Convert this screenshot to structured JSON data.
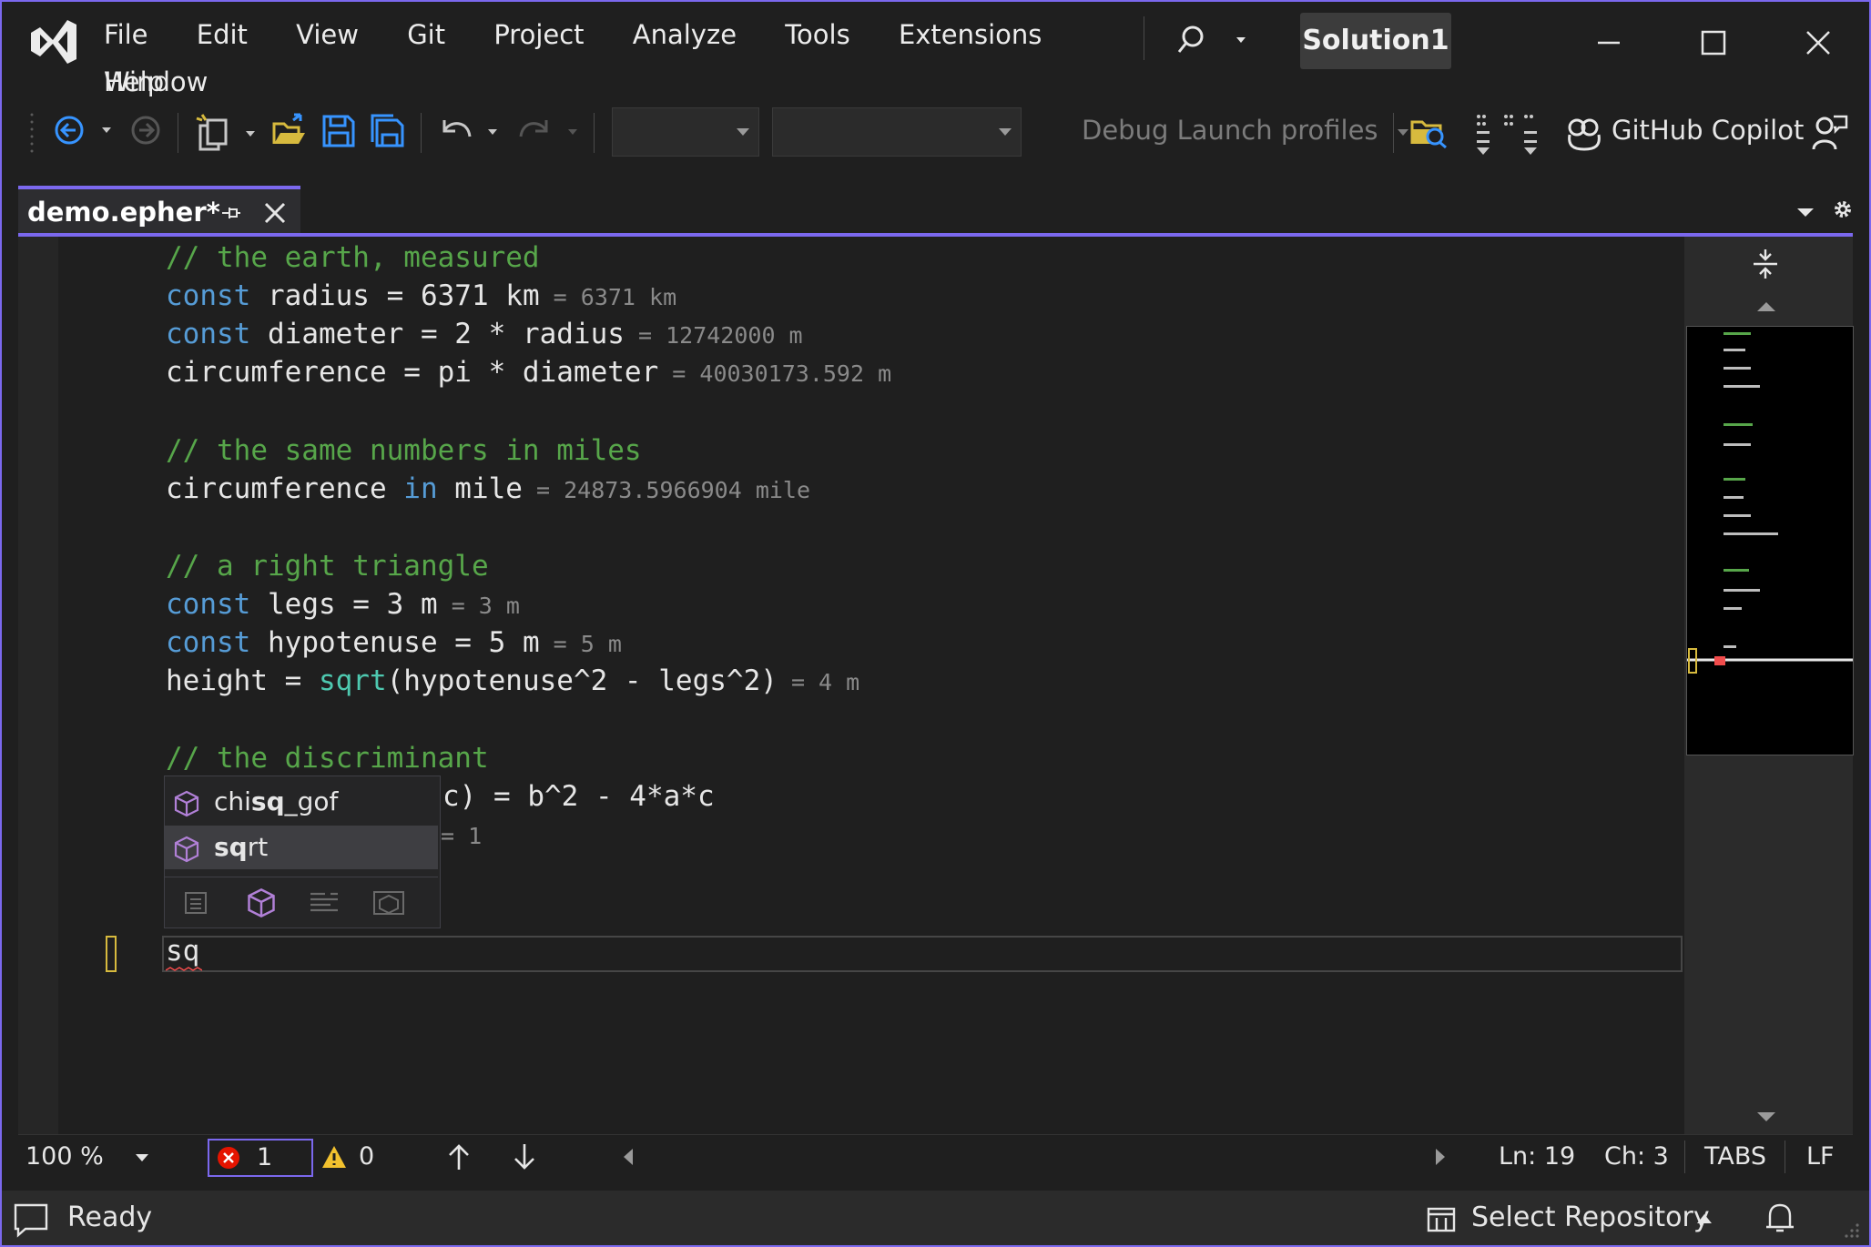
{
  "menu": {
    "items": [
      "File",
      "Edit",
      "View",
      "Git",
      "Project",
      "Analyze",
      "Tools",
      "Extensions",
      "Window"
    ],
    "help": "Help"
  },
  "solution": "Solution1",
  "toolbar": {
    "debug_label": "Debug Launch profiles",
    "copilot_label": "GitHub Copilot"
  },
  "tab": {
    "label": "demo.epher*"
  },
  "code": {
    "l1": "// the earth, measured",
    "l2_kw": "const",
    "l2": " radius = 6371 km",
    "l2_res": " = 6371 km",
    "l3_kw": "const",
    "l3": " diameter = 2 * radius",
    "l3_res": " = 12742000 m",
    "l4": "circumference = pi * diameter",
    "l4_res": " = 40030173.592 m",
    "l6": "// the same numbers in miles",
    "l7_a": "circumference ",
    "l7_kw": "in",
    "l7_b": " mile",
    "l7_res": " = 24873.5966904 mile",
    "l9": "// a right triangle",
    "l10_kw": "const",
    "l10": " legs = 3 m",
    "l10_res": " = 3 m",
    "l11_kw": "const",
    "l11": " hypotenuse = 5 m",
    "l11_res": " = 5 m",
    "l12_a": "height = ",
    "l12_fn": "sqrt",
    "l12_b": "(hypotenuse^2 - legs^2)",
    "l12_res": " = 4 m",
    "l14": "// the discriminant",
    "l15_visible": "c) = b^2 - 4*a*c",
    "l16_visible_res": "= 1",
    "current": "sq"
  },
  "intellisense": {
    "items": [
      {
        "pre": "chi",
        "match": "sq",
        "post": "_gof"
      },
      {
        "pre": "",
        "match": "sq",
        "post": "rt"
      }
    ]
  },
  "editorbar": {
    "zoom": "100 %",
    "errors": "1",
    "warnings": "0",
    "line": "Ln: 19",
    "col": "Ch: 3",
    "indent": "TABS",
    "eol": "LF"
  },
  "status": {
    "ready": "Ready",
    "repo": "Select Repository"
  },
  "colors": {
    "accent": "#7b68ee",
    "comment": "#57a64a",
    "keyword": "#569cd6",
    "function": "#4ec9b0",
    "result": "#8a8a8a"
  }
}
